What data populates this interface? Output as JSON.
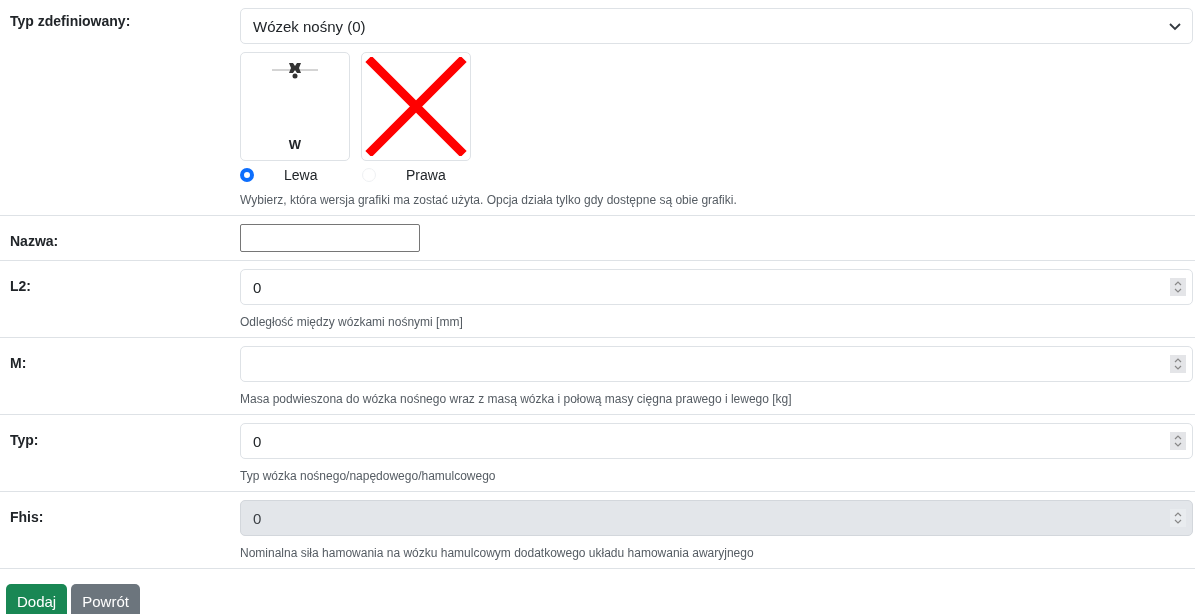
{
  "rows": [
    {
      "kind": "select",
      "label": "Typ zdefiniowany:",
      "value": "Wózek nośny (0)",
      "images": [
        {
          "kind": "drawing",
          "caption": "W"
        },
        {
          "kind": "missing"
        }
      ],
      "radios": [
        {
          "label": "Lewa",
          "selected": true,
          "disabled": false
        },
        {
          "label": "Prawa",
          "selected": false,
          "disabled": true
        }
      ],
      "help": "Wybierz, która wersja grafiki ma zostać użyta. Opcja działa tylko gdy dostępne są obie grafiki."
    },
    {
      "kind": "text",
      "label": "Nazwa:"
    },
    {
      "kind": "number",
      "label": "L2:",
      "value": "0",
      "disabled": false,
      "help": "Odległość między wózkami nośnymi [mm]"
    },
    {
      "kind": "number",
      "label": "M:",
      "disabled": false,
      "help": "Masa podwieszona do wózka nośnego wraz z masą wózka i połową masy cięgna prawego i lewego [kg]"
    },
    {
      "kind": "number",
      "label": "Typ:",
      "value": "0",
      "disabled": false,
      "help": "Typ wózka nośnego/napędowego/hamulcowego"
    },
    {
      "kind": "number",
      "label": "Fhis:",
      "value": "0",
      "disabled": true,
      "help": "Nominalna siła hamowania na wózku hamulcowym dodatkowego układu hamowania awaryjnego"
    }
  ],
  "buttons": [
    {
      "label": "Dodaj",
      "kind": "primary"
    },
    {
      "label": "Powrót",
      "kind": "secondary"
    }
  ]
}
